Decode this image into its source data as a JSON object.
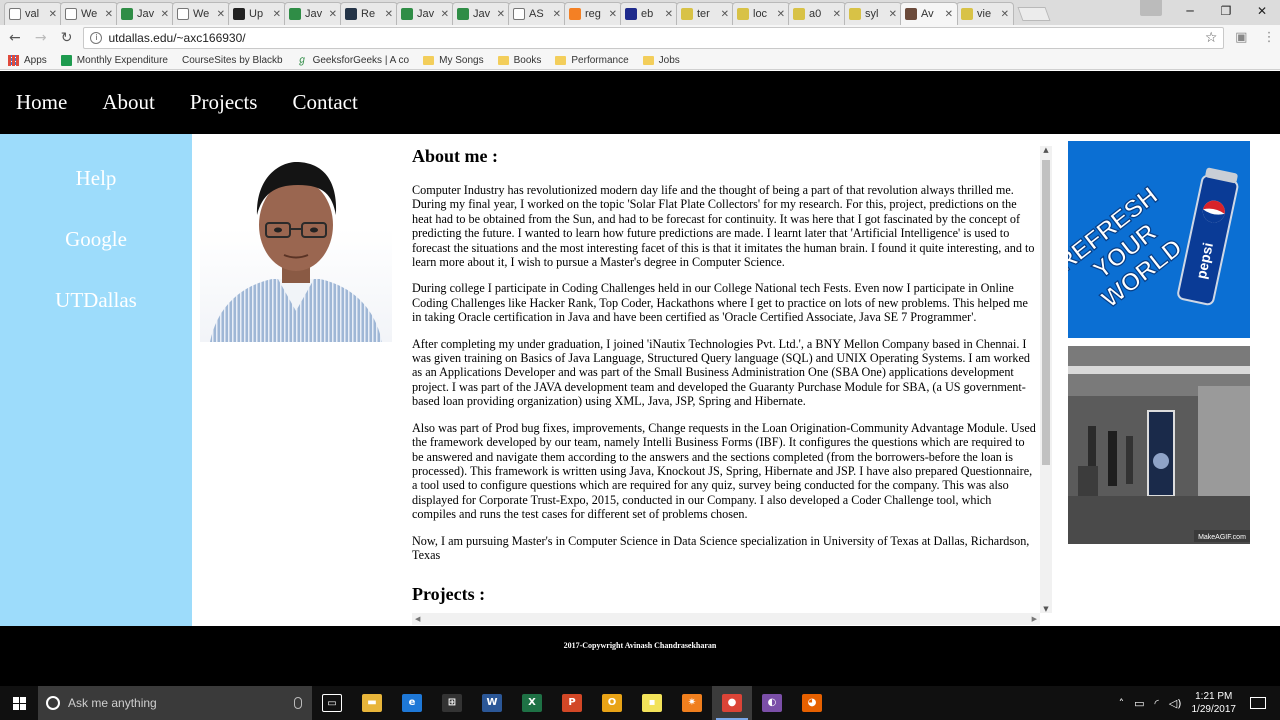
{
  "browser": {
    "tabs": [
      {
        "label": "val",
        "fav": "doc",
        "color": "#ffffff"
      },
      {
        "label": "We",
        "fav": "doc",
        "color": "#ffffff"
      },
      {
        "label": "Jav",
        "fav": "gfg",
        "color": "#2f8d46"
      },
      {
        "label": "We",
        "fav": "doc",
        "color": "#ffffff"
      },
      {
        "label": "Up",
        "fav": "bb",
        "color": "#222222"
      },
      {
        "label": "Jav",
        "fav": "gfg",
        "color": "#2f8d46"
      },
      {
        "label": "Re",
        "fav": "hr",
        "color": "#243447"
      },
      {
        "label": "Jav",
        "fav": "gfg",
        "color": "#2f8d46"
      },
      {
        "label": "Jav",
        "fav": "gfg",
        "color": "#2f8d46"
      },
      {
        "label": "AS",
        "fav": "doc",
        "color": "#ffffff"
      },
      {
        "label": "reg",
        "fav": "so",
        "color": "#f48024"
      },
      {
        "label": "eb",
        "fav": "ebook",
        "color": "#1e2a8c"
      },
      {
        "label": "ter",
        "fav": "w3",
        "color": "#d8c246"
      },
      {
        "label": "loc",
        "fav": "w3",
        "color": "#d8c246"
      },
      {
        "label": "a0",
        "fav": "w3",
        "color": "#d8c246"
      },
      {
        "label": "syl",
        "fav": "w3",
        "color": "#d8c246"
      },
      {
        "label": "Av",
        "fav": "person",
        "color": "#6b4a3a",
        "active": true
      },
      {
        "label": "vie",
        "fav": "w3",
        "color": "#d8c246"
      }
    ],
    "url": "utdallas.edu/~axc166930/",
    "bookmarks": [
      {
        "label": "Apps",
        "icon": "grid"
      },
      {
        "label": "Monthly Expenditure",
        "icon": "sheet"
      },
      {
        "label": "CourseSites by Blackb",
        "icon": "page"
      },
      {
        "label": "GeeksforGeeks | A co",
        "icon": "gfg"
      },
      {
        "label": "My Songs",
        "icon": "folder"
      },
      {
        "label": "Books",
        "icon": "folder"
      },
      {
        "label": "Performance",
        "icon": "folder"
      },
      {
        "label": "Jobs",
        "icon": "folder"
      }
    ]
  },
  "site": {
    "nav": [
      "Home",
      "About",
      "Projects",
      "Contact"
    ],
    "sidebar": [
      "Help",
      "Google",
      "UTDallas"
    ],
    "about_heading": "About me :",
    "paragraphs": [
      "Computer Industry has revolutionized modern day life and the thought of being a part of that revolution always thrilled me. During my final year, I worked on the topic 'Solar Flat Plate Collectors' for my research. For this, project, predictions on the heat had to be obtained from the Sun, and had to be forecast for continuity. It was here that I got fascinated by the concept of predicting the future. I wanted to learn how future predictions are made. I learnt later that 'Artificial Intelligence' is used to forecast the situations and the most interesting facet of this is that it imitates the human brain. I found it quite interesting, and to learn more about it, I wish to pursue a Master's degree in Computer Science.",
      "During college I participate in Coding Challenges held in our College National tech Fests. Even now I participate in Online Coding Challenges like Hacker Rank, Top Coder, Hackathons where I get to practice on lots of new problems. This helped me in taking Oracle certification in Java and have been certified as 'Oracle Certified Associate, Java SE 7 Programmer'.",
      "After completing my under graduation, I joined 'iNautix Technologies Pvt. Ltd.', a BNY Mellon Company based in Chennai. I was given training on Basics of Java Language, Structured Query language (SQL) and UNIX Operating Systems. I am worked as an Applications Developer and was part of the Small Business Administration One (SBA One) applications development project. I was part of the JAVA development team and developed the Guaranty Purchase Module for SBA, (a US government-based loan providing organization) using XML, Java, JSP, Spring and Hibernate.",
      "Also was part of Prod bug fixes, improvements, Change requests in the Loan Origination-Community Advantage Module. Used the framework developed by our team, namely Intelli Business Forms (IBF). It configures the questions which are required to be answered and navigate them according to the answers and the sections completed (from the borrowers-before the loan is processed). This framework is written using Java, Knockout JS, Spring, Hibernate and JSP. I have also prepared Questionnaire, a tool used to configure questions which are required for any quiz, survey being conducted for the company. This was also displayed for Corporate Trust-Expo, 2015, conducted in our Company. I also developed a Coder Challenge tool, which compiles and runs the test cases for different set of problems chosen.",
      "Now, I am pursuing Master's in Computer Science in Data Science specialization in University of Texas at Dallas, Richardson, Texas"
    ],
    "projects_heading": "Projects :",
    "ad1": {
      "line1": "REFRESH",
      "line2": "YOUR",
      "line3": "WORLD",
      "can": "pepsi"
    },
    "ad2": {
      "watermark": "MakeAGIF.com"
    },
    "footer": "2017-Copywright Avinash Chandrasekharan"
  },
  "taskbar": {
    "search_placeholder": "Ask me anything",
    "apps": [
      {
        "name": "task-view",
        "glyph": "▭",
        "color": "#101010"
      },
      {
        "name": "file-explorer",
        "glyph": "▬",
        "color": "#e8b53a"
      },
      {
        "name": "edge",
        "glyph": "e",
        "color": "#1e78d7"
      },
      {
        "name": "store",
        "glyph": "⊞",
        "color": "#333333"
      },
      {
        "name": "word",
        "glyph": "W",
        "color": "#2b5797"
      },
      {
        "name": "excel",
        "glyph": "X",
        "color": "#1e7145"
      },
      {
        "name": "powerpoint",
        "glyph": "P",
        "color": "#d24726"
      },
      {
        "name": "outlook",
        "glyph": "O",
        "color": "#e8a317"
      },
      {
        "name": "sticky-notes",
        "glyph": "▪",
        "color": "#f2e25a"
      },
      {
        "name": "orange-app",
        "glyph": "✷",
        "color": "#f07f1e"
      },
      {
        "name": "chrome",
        "glyph": "●",
        "color": "#db4437",
        "active": true
      },
      {
        "name": "purple-app",
        "glyph": "◐",
        "color": "#7b4fa8"
      },
      {
        "name": "firefox",
        "glyph": "◕",
        "color": "#e66000"
      }
    ],
    "time": "1:21 PM",
    "date": "1/29/2017"
  }
}
